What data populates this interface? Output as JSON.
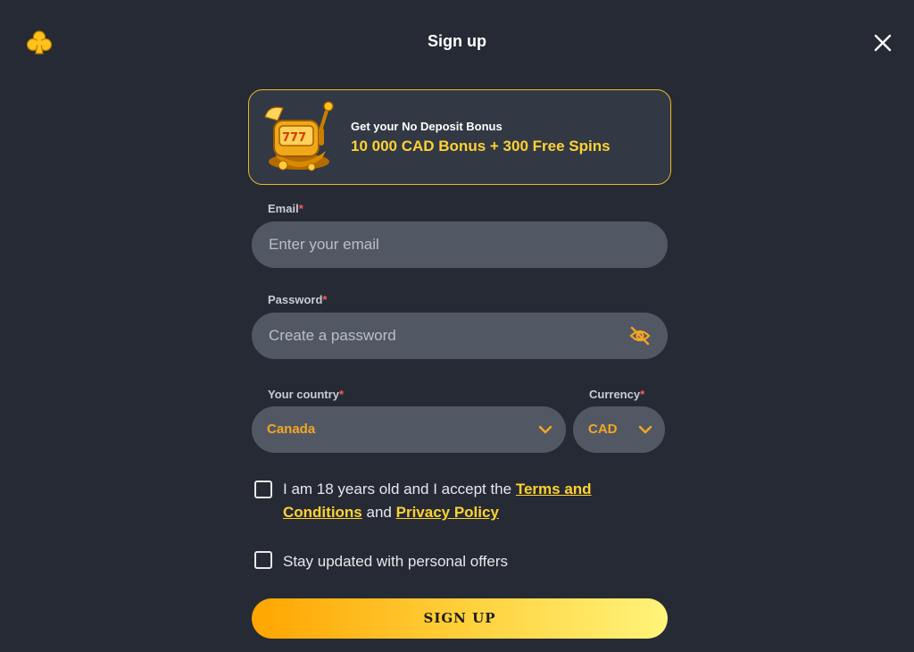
{
  "header": {
    "title": "Sign up",
    "logo_icon": "club-icon",
    "close_icon": "close-icon"
  },
  "bonus": {
    "small": "Get your No Deposit Bonus",
    "big": "10 000 CAD Bonus + 300 Free Spins",
    "image": "slot-machine-icon"
  },
  "form": {
    "email_label": "Email",
    "email_placeholder": "Enter your email",
    "email_value": "",
    "password_label": "Password",
    "password_placeholder": "Create a password",
    "password_value": "",
    "country_label": "Your country",
    "country_value": "Canada",
    "currency_label": "Currency",
    "currency_value": "CAD",
    "required_mark": "*"
  },
  "consent": {
    "age_prefix": "I am 18 years old and I accept the",
    "terms_link": "Terms and Conditions",
    "and": "and",
    "privacy_link": "Privacy Policy",
    "offers": "Stay updated with personal offers",
    "age_checked": false,
    "offers_checked": false
  },
  "submit_label": "SIGN UP",
  "colors": {
    "background": "#262a34",
    "accent": "#f5a623",
    "link": "#ffd232",
    "input_bg": "#525863",
    "bonus_border": "#e8b923"
  }
}
